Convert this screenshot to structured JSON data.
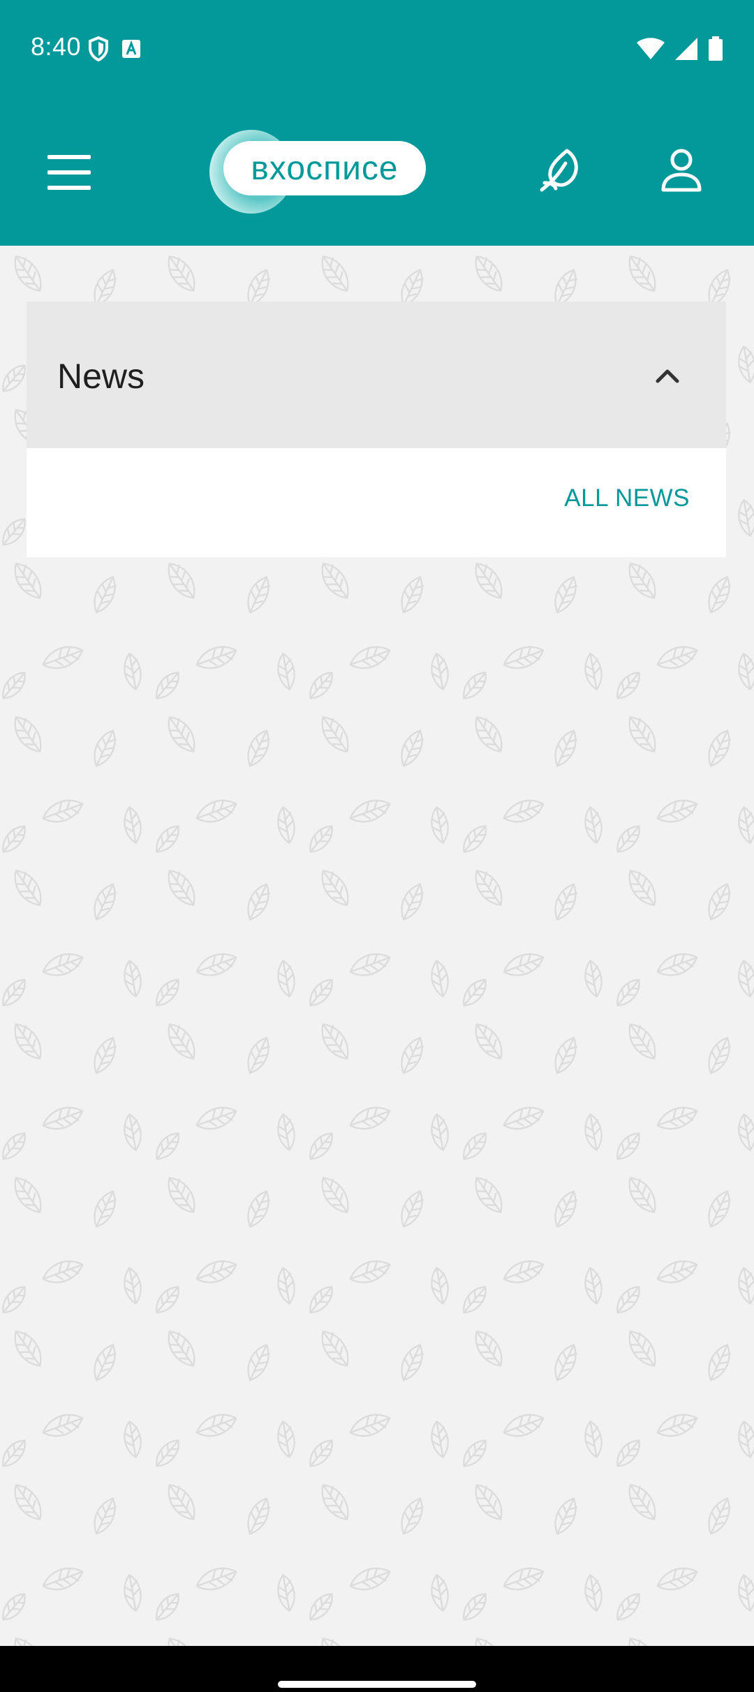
{
  "status_bar": {
    "time": "8:40",
    "left_icons": [
      "shield-icon",
      "keyboard-a-icon"
    ],
    "right_icons": [
      "wifi-icon",
      "cell-signal-icon",
      "battery-icon"
    ]
  },
  "app_bar": {
    "logo_text": "вхосписе",
    "menu_icon": "menu-icon",
    "leaf_icon": "leaf-icon",
    "profile_icon": "person-icon",
    "background": "#03999b"
  },
  "news": {
    "title": "News",
    "toggle_icon": "chevron-up-icon",
    "all_news_label": "ALL NEWS"
  },
  "colors": {
    "accent": "#03999b",
    "page_background": "#f2f2f2",
    "card_header": "#e8e8e8"
  }
}
